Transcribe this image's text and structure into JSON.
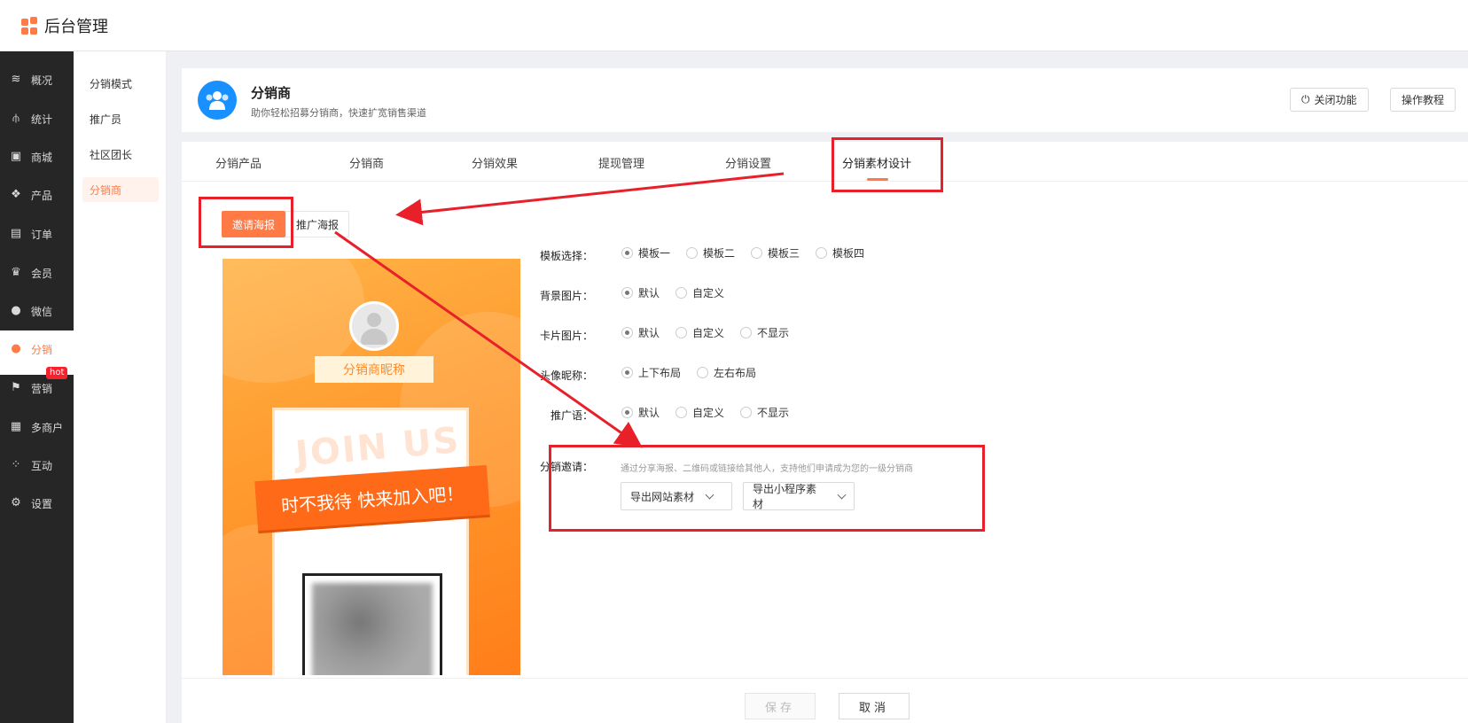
{
  "app": {
    "title": "后台管理"
  },
  "sidebar": {
    "items": [
      {
        "label": "概况",
        "icon": "layers-icon",
        "glyph": "≋"
      },
      {
        "label": "统计",
        "icon": "chart-icon",
        "glyph": "⫛"
      },
      {
        "label": "商城",
        "icon": "shop-icon",
        "glyph": "▣"
      },
      {
        "label": "产品",
        "icon": "grid-icon",
        "glyph": "❖"
      },
      {
        "label": "订单",
        "icon": "order-icon",
        "glyph": "▤"
      },
      {
        "label": "会员",
        "icon": "crown-icon",
        "glyph": "♛"
      },
      {
        "label": "微信",
        "icon": "wechat-icon",
        "glyph": "●"
      },
      {
        "label": "分销",
        "icon": "user-icon",
        "glyph": "●"
      },
      {
        "label": "营销",
        "icon": "flag-icon",
        "glyph": "⚑"
      },
      {
        "label": "多商户",
        "icon": "store-icon",
        "glyph": "▦"
      },
      {
        "label": "互动",
        "icon": "apps-icon",
        "glyph": "⁘"
      },
      {
        "label": "设置",
        "icon": "gear-icon",
        "glyph": "⚙"
      }
    ],
    "hot_badge": "hot"
  },
  "submenu": {
    "items": [
      {
        "label": "分销模式"
      },
      {
        "label": "推广员"
      },
      {
        "label": "社区团长"
      },
      {
        "label": "分销商"
      }
    ]
  },
  "header": {
    "title": "分销商",
    "subtitle": "助你轻松招募分销商，快速扩宽销售渠道",
    "close_button": "关闭功能",
    "tutorial_button": "操作教程"
  },
  "tabs": [
    {
      "label": "分销产品"
    },
    {
      "label": "分销商"
    },
    {
      "label": "分销效果"
    },
    {
      "label": "提现管理"
    },
    {
      "label": "分销设置"
    },
    {
      "label": "分销素材设计"
    }
  ],
  "subtabs": {
    "invite": "邀请海报",
    "promo": "推广海报"
  },
  "poster": {
    "nickname": "分销商昵称",
    "watermark": "JOIN US",
    "slogan": "时不我待 快来加入吧！"
  },
  "form": {
    "template": {
      "label": "模板选择：",
      "options": [
        "模板一",
        "模板二",
        "模板三",
        "模板四"
      ]
    },
    "background": {
      "label": "背景图片：",
      "options": [
        "默认",
        "自定义"
      ]
    },
    "card": {
      "label": "卡片图片：",
      "options": [
        "默认",
        "自定义",
        "不显示"
      ]
    },
    "avatar": {
      "label": "头像昵称：",
      "options": [
        "上下布局",
        "左右布局"
      ]
    },
    "slogan": {
      "label": "推广语：",
      "options": [
        "默认",
        "自定义",
        "不显示"
      ]
    },
    "invite": {
      "label": "分销邀请：",
      "desc": "通过分享海报、二维码或链接给其他人，支持他们申请成为您的一级分销商",
      "export_web": "导出网站素材",
      "export_mini": "导出小程序素材"
    }
  },
  "footer": {
    "save": "保存",
    "cancel": "取消"
  },
  "colors": {
    "accent": "#ff7a45",
    "sidebar": "#262626",
    "annotation": "#e8202a"
  }
}
